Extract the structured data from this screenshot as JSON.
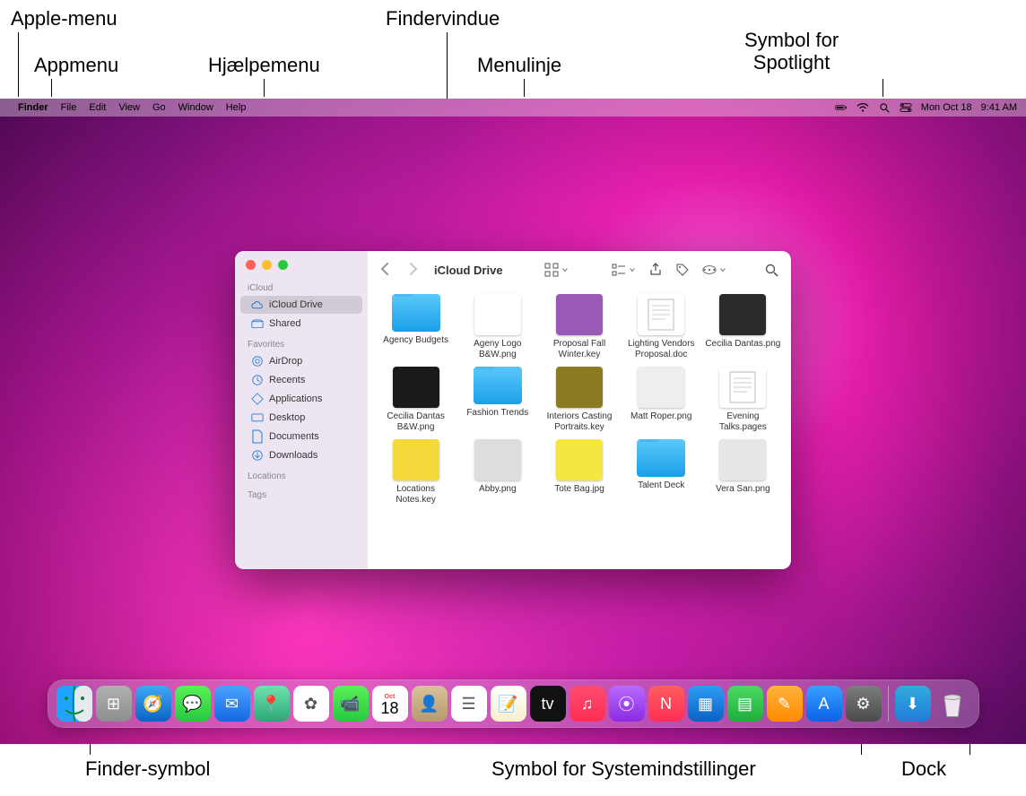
{
  "annotations": {
    "apple_menu": "Apple-menu",
    "app_menu": "Appmenu",
    "help_menu": "Hjælpemenu",
    "finder_window": "Findervindue",
    "menubar": "Menulinje",
    "spotlight": "Symbol for\nSpotlight",
    "finder_icon": "Finder-symbol",
    "sysprefs_icon": "Symbol for Systemindstillinger",
    "dock": "Dock"
  },
  "menubar": {
    "apple": "",
    "app": "Finder",
    "items": [
      "File",
      "Edit",
      "View",
      "Go",
      "Window",
      "Help"
    ],
    "date": "Mon Oct 18",
    "time": "9:41 AM"
  },
  "finder": {
    "title": "iCloud Drive",
    "sidebar": {
      "sections": [
        {
          "label": "iCloud",
          "items": [
            {
              "name": "iCloud Drive",
              "icon": "cloud",
              "selected": true
            },
            {
              "name": "Shared",
              "icon": "shared",
              "selected": false
            }
          ]
        },
        {
          "label": "Favorites",
          "items": [
            {
              "name": "AirDrop",
              "icon": "airdrop"
            },
            {
              "name": "Recents",
              "icon": "clock"
            },
            {
              "name": "Applications",
              "icon": "apps"
            },
            {
              "name": "Desktop",
              "icon": "desktop"
            },
            {
              "name": "Documents",
              "icon": "doc"
            },
            {
              "name": "Downloads",
              "icon": "download"
            }
          ]
        },
        {
          "label": "Locations",
          "items": []
        },
        {
          "label": "Tags",
          "items": []
        }
      ]
    },
    "files": [
      {
        "name": "Agency Budgets",
        "kind": "folder"
      },
      {
        "name": "Ageny Logo B&W.png",
        "kind": "image",
        "bg": "#ffffff"
      },
      {
        "name": "Proposal Fall Winter.key",
        "kind": "image",
        "bg": "#9b59b6"
      },
      {
        "name": "Lighting Vendors Proposal.doc",
        "kind": "doc",
        "bg": "#ffffff"
      },
      {
        "name": "Cecilia Dantas.png",
        "kind": "image",
        "bg": "#2b2b2b"
      },
      {
        "name": "Cecilia Dantas B&W.png",
        "kind": "image",
        "bg": "#1a1a1a"
      },
      {
        "name": "Fashion Trends",
        "kind": "folder"
      },
      {
        "name": "Interiors Casting Portraits.key",
        "kind": "image",
        "bg": "#8a7a22"
      },
      {
        "name": "Matt Roper.png",
        "kind": "image",
        "bg": "#eee"
      },
      {
        "name": "Evening Talks.pages",
        "kind": "doc",
        "bg": "#ffffff"
      },
      {
        "name": "Locations Notes.key",
        "kind": "image",
        "bg": "#f3d93a"
      },
      {
        "name": "Abby.png",
        "kind": "image",
        "bg": "#ddd"
      },
      {
        "name": "Tote Bag.jpg",
        "kind": "image",
        "bg": "#f5e642"
      },
      {
        "name": "Talent Deck",
        "kind": "folder"
      },
      {
        "name": "Vera San.png",
        "kind": "image",
        "bg": "#e7e7e7"
      }
    ]
  },
  "dock": {
    "apps": [
      {
        "name": "Finder",
        "bg": "linear-gradient(#34aadc,#1f7dd9)",
        "glyph": "🙂"
      },
      {
        "name": "Launchpad",
        "bg": "linear-gradient(#b0b0b0,#8e8e8e)",
        "glyph": "⊞"
      },
      {
        "name": "Safari",
        "bg": "linear-gradient(#3fa9f5,#0b62c4)",
        "glyph": "🧭"
      },
      {
        "name": "Messages",
        "bg": "linear-gradient(#5af158,#28c840)",
        "glyph": "💬"
      },
      {
        "name": "Mail",
        "bg": "linear-gradient(#4aa3ff,#1668e3)",
        "glyph": "✉︎"
      },
      {
        "name": "Maps",
        "bg": "linear-gradient(#6fe3b0,#2aa876)",
        "glyph": "📍"
      },
      {
        "name": "Photos",
        "bg": "#fff",
        "glyph": "✿"
      },
      {
        "name": "FaceTime",
        "bg": "linear-gradient(#5af158,#28c840)",
        "glyph": "📹"
      },
      {
        "name": "Calendar",
        "bg": "#fff",
        "glyph": "18"
      },
      {
        "name": "Contacts",
        "bg": "linear-gradient(#d9c29c,#b89a6b)",
        "glyph": "👤"
      },
      {
        "name": "Reminders",
        "bg": "#fff",
        "glyph": "☰"
      },
      {
        "name": "Notes",
        "bg": "linear-gradient(#fff,#f8efc9)",
        "glyph": "📝"
      },
      {
        "name": "TV",
        "bg": "#111",
        "glyph": "tv"
      },
      {
        "name": "Music",
        "bg": "linear-gradient(#ff4b6e,#ff2d55)",
        "glyph": "♫"
      },
      {
        "name": "Podcasts",
        "bg": "linear-gradient(#b96bff,#8a2be2)",
        "glyph": "⦿"
      },
      {
        "name": "News",
        "bg": "linear-gradient(#ff5e5e,#ff2d55)",
        "glyph": "N"
      },
      {
        "name": "Keynote",
        "bg": "linear-gradient(#2f9cf4,#0a62c4)",
        "glyph": "▦"
      },
      {
        "name": "Numbers",
        "bg": "linear-gradient(#4cd964,#1fae3c)",
        "glyph": "▤"
      },
      {
        "name": "Pages",
        "bg": "linear-gradient(#ffb13d,#ff8b00)",
        "glyph": "✎"
      },
      {
        "name": "App Store",
        "bg": "linear-gradient(#3aa0ff,#0a62e8)",
        "glyph": "A"
      },
      {
        "name": "System Preferences",
        "bg": "linear-gradient(#7d7d7d,#4a4a4a)",
        "glyph": "⚙︎"
      }
    ],
    "extras": [
      {
        "name": "Downloads",
        "bg": "linear-gradient(#34aadc,#1f7dd9)",
        "glyph": "⬇︎"
      },
      {
        "name": "Trash",
        "bg": "rgba(255,255,255,.25)",
        "glyph": "🗑"
      }
    ]
  }
}
